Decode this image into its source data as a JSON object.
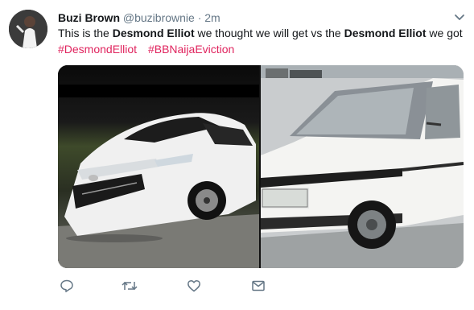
{
  "tweet": {
    "display_name": "Buzi Brown",
    "handle": "@buzibrownie",
    "separator": "·",
    "time": "2m",
    "text_parts": {
      "p1": "This is the ",
      "name1": "Desmond Elliot",
      "p2": " we thought we will get vs the ",
      "name2": "Desmond Elliot",
      "p3": " we got"
    },
    "hashtags": [
      "#DesmondElliot",
      "#BBNaijaEviction"
    ]
  },
  "icons": {
    "menu": "chevron-down-icon",
    "reply": "reply-icon",
    "retweet": "retweet-icon",
    "like": "heart-icon",
    "message": "envelope-icon"
  },
  "colors": {
    "hashtag": "#e0245e",
    "secondary_text": "#657786",
    "icon": "#657786"
  }
}
